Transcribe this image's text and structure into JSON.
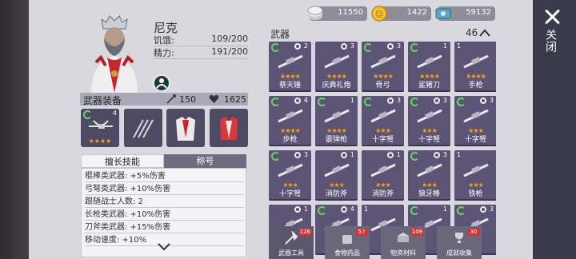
{
  "character": {
    "name": "尼克",
    "hunger_label": "饥饿:",
    "hunger_value": "109/200",
    "energy_label": "精力:",
    "energy_value": "191/200"
  },
  "equipment": {
    "title": "武器装备",
    "attack": "150",
    "defense": "1625",
    "slots": [
      {
        "name": "weapon-slot",
        "count": "4"
      },
      {
        "name": "claw-slot"
      },
      {
        "name": "armor-slot"
      },
      {
        "name": "vest-slot"
      }
    ]
  },
  "tabs": {
    "skills": "擅长技能",
    "title": "称号"
  },
  "skills": [
    "棍棒类武器: +5%伤害",
    "弓弩类武器: +10%伤害",
    "跟随战士人数: 2",
    "长枪类武器: +10%伤害",
    "刀斧类武器: +15%伤害",
    "移动速度: +10%"
  ],
  "resources": {
    "silver": "11550",
    "gold": "1422",
    "cash": "59132"
  },
  "close_label": "关闭",
  "weapons_panel": {
    "title": "武器",
    "count": "46",
    "items": [
      {
        "label": "祭天锤",
        "stars": "★★★★",
        "count": "2",
        "recycle": true,
        "gear": true
      },
      {
        "label": "庆典礼炮",
        "stars": "★★★★",
        "count": "3",
        "recycle": false,
        "gear": true
      },
      {
        "label": "骨弓",
        "stars": "★★★★",
        "count": "3",
        "recycle": true,
        "gear": true
      },
      {
        "label": "鲨猪刀",
        "stars": "★★★★",
        "count": "1",
        "recycle": true,
        "gear": false
      },
      {
        "label": "手枪",
        "stars": "★★★★",
        "count": "1",
        "recycle": false,
        "gear": false
      },
      {
        "label": "步枪",
        "stars": "★★★★",
        "count": "4",
        "recycle": true,
        "gear": true
      },
      {
        "label": "霰弹枪",
        "stars": "★★★★",
        "count": "1",
        "recycle": true,
        "gear": false
      },
      {
        "label": "十字弩",
        "stars": "★★★",
        "count": "3",
        "recycle": true,
        "gear": true
      },
      {
        "label": "十字弩",
        "stars": "★★★",
        "count": "3",
        "recycle": true,
        "gear": true
      },
      {
        "label": "十字弩",
        "stars": "★★★",
        "count": "3",
        "recycle": true,
        "gear": true
      },
      {
        "label": "十字弩",
        "stars": "★★★",
        "count": "3",
        "recycle": true,
        "gear": true
      },
      {
        "label": "消防斧",
        "stars": "★★★",
        "count": "1",
        "recycle": false,
        "gear": true
      },
      {
        "label": "消防斧",
        "stars": "★★★",
        "count": "1",
        "recycle": false,
        "gear": true
      },
      {
        "label": "狼牙棒",
        "stars": "★★★",
        "count": "3",
        "recycle": true,
        "gear": true
      },
      {
        "label": "铁枪",
        "stars": "★★★",
        "count": "1",
        "recycle": false,
        "gear": false
      },
      {
        "label": "",
        "stars": "",
        "count": "1",
        "recycle": false,
        "gear": true
      },
      {
        "label": "",
        "stars": "",
        "count": "4",
        "recycle": true,
        "gear": true
      },
      {
        "label": "",
        "stars": "",
        "count": "1",
        "recycle": false,
        "gear": false
      },
      {
        "label": "",
        "stars": "",
        "count": "1",
        "recycle": true,
        "gear": false
      },
      {
        "label": "",
        "stars": "",
        "count": "3",
        "recycle": true,
        "gear": true
      }
    ]
  },
  "bottom_tabs": [
    {
      "label": "武器工具",
      "badge": "126",
      "active": true
    },
    {
      "label": "食物药品",
      "badge": "57",
      "active": false
    },
    {
      "label": "物资材料",
      "badge": "149",
      "active": false
    },
    {
      "label": "成就收集",
      "badge": "30",
      "active": false
    }
  ],
  "colors": {
    "star": "#f2a51c",
    "card_bg": "#5c5475",
    "panel_bg": "#d9d8df",
    "close_bar": "#3b3a4a",
    "badge": "#c8383f",
    "recycle": "#6dd06a"
  }
}
